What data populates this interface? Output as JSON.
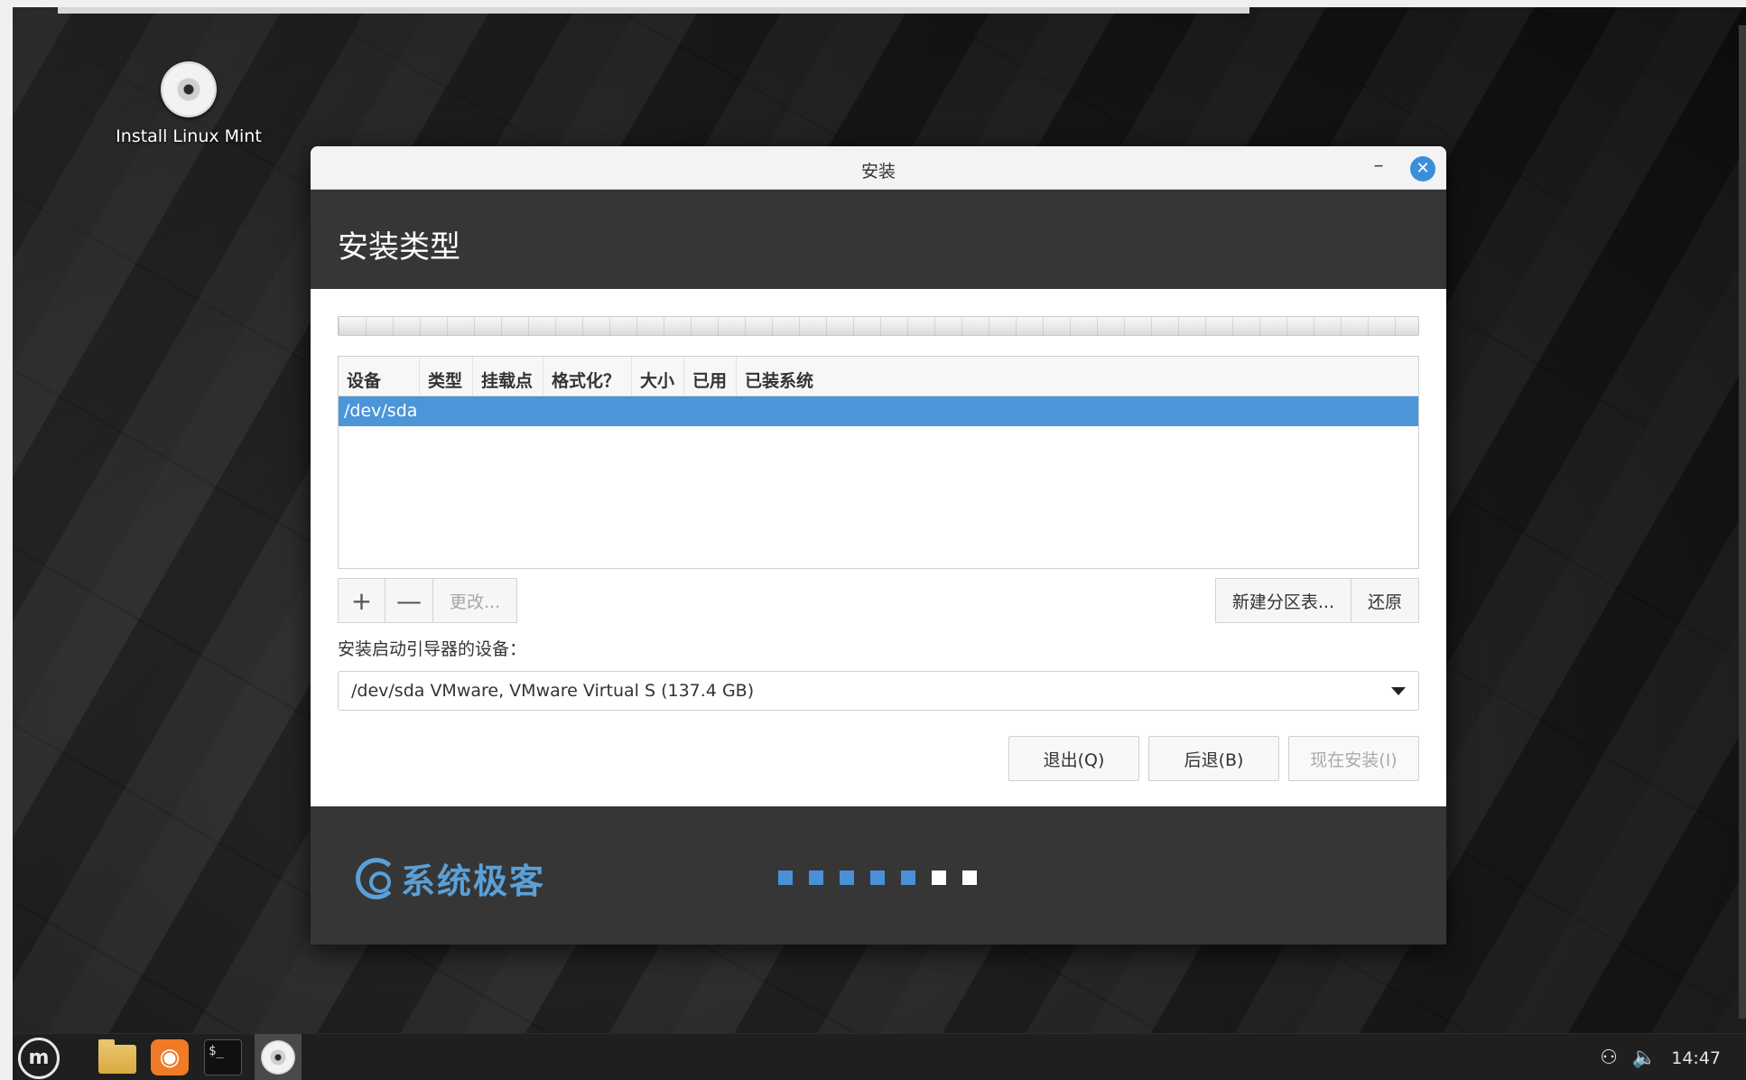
{
  "desktop": {
    "icon_label": "Install Linux Mint"
  },
  "window": {
    "title": "安装",
    "minimize_symbol": "–",
    "close_symbol": "✕",
    "page_title": "安装类型"
  },
  "partition_table": {
    "columns": [
      "设备",
      "类型",
      "挂载点",
      "格式化？",
      "大小",
      "已用",
      "已装系统"
    ],
    "rows": [
      {
        "device": "/dev/sda"
      }
    ]
  },
  "toolbar": {
    "add_symbol": "+",
    "remove_symbol": "—",
    "change_label": "更改...",
    "new_table_label": "新建分区表...",
    "revert_label": "还原"
  },
  "bootloader": {
    "label": "安装启动引导器的设备：",
    "selected": "/dev/sda VMware, VMware Virtual S (137.4 GB)"
  },
  "actions": {
    "quit_label": "退出(Q)",
    "back_label": "后退(B)",
    "install_label": "现在安装(I)"
  },
  "footer": {
    "brand_text": "系统极客",
    "progress_total": 7,
    "progress_done": 5
  },
  "taskbar": {
    "menu_symbol": "m",
    "firefox_symbol": "◉",
    "terminal_symbol": "$_",
    "clock": "14:47"
  },
  "colors": {
    "accent": "#4a90d9",
    "header_bg": "#363636",
    "selected_row": "#4b95d8"
  }
}
